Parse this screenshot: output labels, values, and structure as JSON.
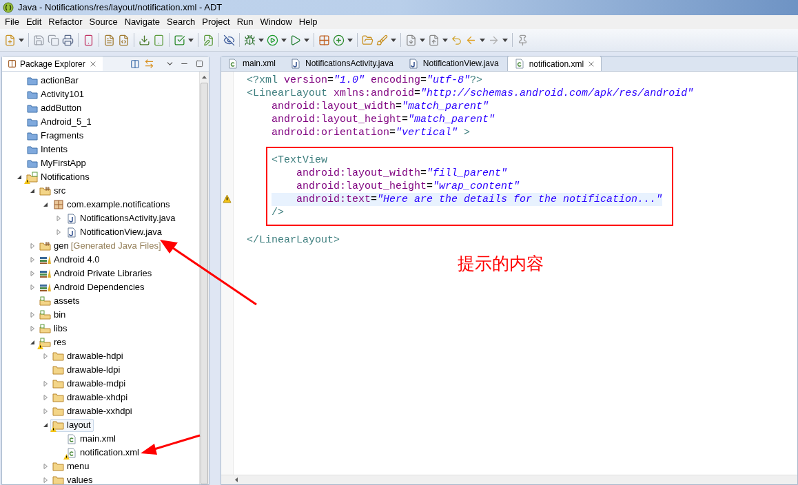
{
  "window": {
    "title": "Java - Notifications/res/layout/notification.xml - ADT"
  },
  "menubar": {
    "items": [
      "File",
      "Edit",
      "Refactor",
      "Source",
      "Navigate",
      "Search",
      "Project",
      "Run",
      "Window",
      "Help"
    ]
  },
  "package_explorer": {
    "tab": {
      "label": "Package Explorer",
      "selected": true
    },
    "tree": [
      {
        "label": "actionBar",
        "kind": "project",
        "selected": false
      },
      {
        "label": "Activity101",
        "kind": "project",
        "selected": false
      },
      {
        "label": "addButton",
        "kind": "project",
        "selected": false
      },
      {
        "label": "Android_5_1",
        "kind": "project",
        "selected": false
      },
      {
        "label": "Fragments",
        "kind": "project",
        "selected": false
      },
      {
        "label": "Intents",
        "kind": "project",
        "selected": false
      },
      {
        "label": "MyFirstApp",
        "kind": "project",
        "selected": false
      },
      {
        "label": "Notifications",
        "kind": "android-project",
        "warning": true,
        "expanded": true,
        "selected": false,
        "children": [
          {
            "label": "src",
            "kind": "source-folder",
            "expanded": true,
            "selected": false,
            "children": [
              {
                "label": "com.example.notifications",
                "kind": "package",
                "expanded": true,
                "selected": false,
                "children": [
                  {
                    "label": "NotificationsActivity.java",
                    "kind": "java",
                    "expanded": false,
                    "selected": false
                  },
                  {
                    "label": "NotificationView.java",
                    "kind": "java",
                    "expanded": false,
                    "selected": false
                  }
                ]
              }
            ]
          },
          {
            "label": "gen",
            "decoration": "[Generated Java Files]",
            "kind": "source-folder",
            "expanded": false,
            "selected": false
          },
          {
            "label": "Android 4.0",
            "kind": "library",
            "expanded": false,
            "selected": false
          },
          {
            "label": "Android Private Libraries",
            "kind": "library",
            "expanded": false,
            "selected": false
          },
          {
            "label": "Android Dependencies",
            "kind": "library",
            "expanded": false,
            "selected": false
          },
          {
            "label": "assets",
            "kind": "android-folder",
            "selected": false
          },
          {
            "label": "bin",
            "kind": "android-folder",
            "expanded": false,
            "selected": false
          },
          {
            "label": "libs",
            "kind": "android-folder",
            "expanded": false,
            "selected": false
          },
          {
            "label": "res",
            "kind": "android-folder",
            "warning": true,
            "expanded": true,
            "selected": false,
            "children": [
              {
                "label": "drawable-hdpi",
                "kind": "folder",
                "expanded": false,
                "selected": false
              },
              {
                "label": "drawable-ldpi",
                "kind": "folder",
                "selected": false
              },
              {
                "label": "drawable-mdpi",
                "kind": "folder",
                "expanded": false,
                "selected": false
              },
              {
                "label": "drawable-xhdpi",
                "kind": "folder",
                "expanded": false,
                "selected": false
              },
              {
                "label": "drawable-xxhdpi",
                "kind": "folder",
                "expanded": false,
                "selected": false
              },
              {
                "label": "layout",
                "kind": "folder",
                "warning": true,
                "expanded": true,
                "selected": true,
                "children": [
                  {
                    "label": "main.xml",
                    "kind": "xml",
                    "selected": false
                  },
                  {
                    "label": "notification.xml",
                    "kind": "xml",
                    "warning": true,
                    "selected": false
                  }
                ]
              },
              {
                "label": "menu",
                "kind": "folder",
                "expanded": false,
                "selected": false
              },
              {
                "label": "values",
                "kind": "folder",
                "expanded": false,
                "selected": false
              }
            ]
          }
        ]
      }
    ]
  },
  "editor": {
    "tabs": [
      {
        "label": "main.xml",
        "kind": "xml",
        "selected": false
      },
      {
        "label": "NotificationsActivity.java",
        "kind": "java",
        "selected": false
      },
      {
        "label": "NotificationView.java",
        "kind": "java",
        "selected": false
      },
      {
        "label": "notification.xml",
        "kind": "xml",
        "selected": true
      }
    ],
    "code": {
      "prolog": [
        {
          "kind": "tag",
          "text": "<?xml"
        },
        {
          "kind": "attr",
          "text": " version"
        },
        {
          "kind": "punct",
          "text": "="
        },
        {
          "kind": "value",
          "text": "\"1.0\""
        },
        {
          "kind": "attr",
          "text": " encoding"
        },
        {
          "kind": "punct",
          "text": "="
        },
        {
          "kind": "value",
          "text": "\"utf-8\""
        },
        {
          "kind": "tag",
          "text": "?>"
        }
      ],
      "root": {
        "open": [
          {
            "kind": "tag",
            "text": "<LinearLayout"
          },
          {
            "kind": "attr",
            "text": " xmlns:android"
          },
          {
            "kind": "punct",
            "text": "="
          },
          {
            "kind": "value",
            "text": "\"http://schemas.android.com/apk/res/android\""
          }
        ],
        "attributes": [
          {
            "current": false,
            "segments": [
              {
                "kind": "attr",
                "text": "android:layout_width"
              },
              {
                "kind": "punct",
                "text": "="
              },
              {
                "kind": "value",
                "text": "\"match_parent\""
              }
            ]
          },
          {
            "current": false,
            "segments": [
              {
                "kind": "attr",
                "text": "android:layout_height"
              },
              {
                "kind": "punct",
                "text": "="
              },
              {
                "kind": "value",
                "text": "\"match_parent\""
              }
            ]
          },
          {
            "current": false,
            "segments": [
              {
                "kind": "attr",
                "text": "android:orientation"
              },
              {
                "kind": "punct",
                "text": "="
              },
              {
                "kind": "value",
                "text": "\"vertical\""
              },
              {
                "kind": "tag",
                "text": " >"
              }
            ]
          }
        ],
        "children": [
          {
            "boxed": true,
            "open": [
              {
                "kind": "tag",
                "text": "<TextView"
              }
            ],
            "attributes": [
              {
                "current": false,
                "segments": [
                  {
                    "kind": "attr",
                    "text": "android:layout_width"
                  },
                  {
                    "kind": "punct",
                    "text": "="
                  },
                  {
                    "kind": "value",
                    "text": "\"fill_parent\""
                  }
                ]
              },
              {
                "current": false,
                "segments": [
                  {
                    "kind": "attr",
                    "text": "android:layout_height"
                  },
                  {
                    "kind": "punct",
                    "text": "="
                  },
                  {
                    "kind": "value",
                    "text": "\"wrap_content\""
                  }
                ]
              },
              {
                "current": true,
                "warning": true,
                "segments": [
                  {
                    "kind": "attr",
                    "text": "android:text"
                  },
                  {
                    "kind": "punct",
                    "text": "="
                  },
                  {
                    "kind": "value",
                    "text": "\"Here are the details for the notification...\""
                  }
                ]
              }
            ],
            "close": [
              {
                "kind": "tag",
                "text": "/>"
              }
            ]
          }
        ],
        "close": [
          {
            "kind": "tag",
            "text": "</LinearLayout>"
          }
        ]
      }
    }
  },
  "annotation": {
    "label": "提示的内容"
  }
}
